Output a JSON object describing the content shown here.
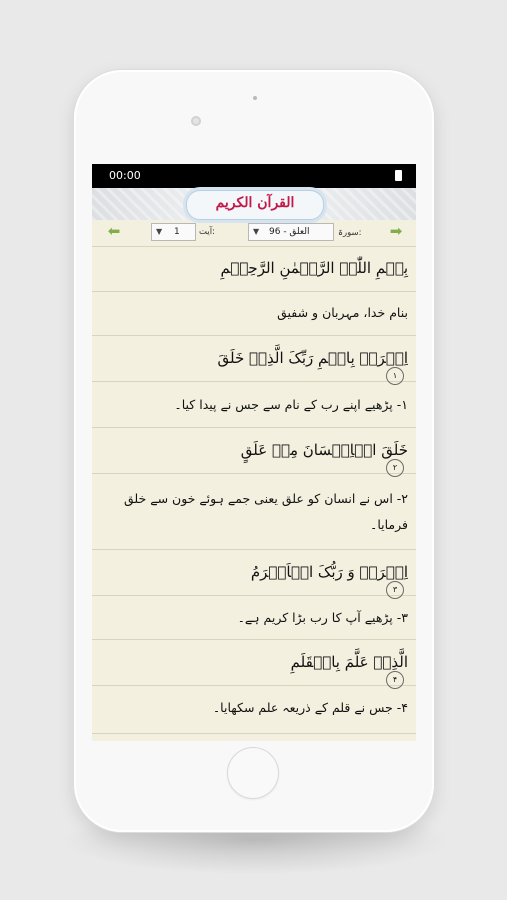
{
  "status": {
    "time": "00:00"
  },
  "app": {
    "title": "القرآن الکریم"
  },
  "nav": {
    "surah_label": "سورۃ:",
    "surah_value": "96 - العلق",
    "ayah_label": "آیت:",
    "ayah_value": "1"
  },
  "verses": [
    {
      "text": "بِسۡمِ اللّٰہِ الرَّحۡمٰنِ الرَّحِیۡمِ"
    },
    {
      "text": "بنام خدا، مہربان و شفیق"
    },
    {
      "text": "اِقۡرَاۡ بِاسۡمِ رَبِّکَ الَّذِیۡ خَلَقَ",
      "number": "۱"
    },
    {
      "text": "۱- پڑھیے اپنے رب کے نام سے جس نے پیدا کیا۔"
    },
    {
      "text": "خَلَقَ الۡاِنۡسَانَ مِنۡ عَلَقٍ",
      "number": "۲"
    },
    {
      "text": "۲- اس نے انسان کو علق یعنی جمے ہوئے خون سے خلق فرمایا۔"
    },
    {
      "text": "اِقۡرَاۡ وَ رَبُّکَ الۡاَکۡرَمُ",
      "number": "۳"
    },
    {
      "text": "۳- پڑھیے آپ کا رب بڑا کریم ہے۔"
    },
    {
      "text": "الَّذِیۡ عَلَّمَ بِالۡقَلَمِ",
      "number": "۴"
    },
    {
      "text": "۴- جس نے قلم کے ذریعہ علم سکھایا۔"
    }
  ],
  "icons": {
    "prev": "arrow-left-icon",
    "next": "arrow-right-icon",
    "battery": "battery-icon"
  },
  "colors": {
    "accent": "#7fae4b",
    "title": "#c2194a",
    "paper": "#f3f0df",
    "rule": "#d9d4bd"
  }
}
